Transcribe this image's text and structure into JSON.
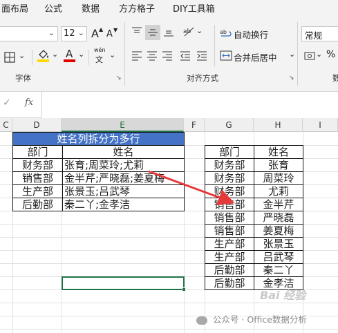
{
  "ribbon": {
    "tabs": [
      "面布局",
      "公式",
      "数据",
      "方方格子",
      "DIY工具箱"
    ],
    "font_size_value": "12",
    "grow_font_label": "A",
    "shrink_font_label": "A",
    "font_color_label": "A",
    "phonetic_label": "wén",
    "phonetic_sub": "文",
    "wrap_text_label": "自动换行",
    "merge_center_label": "合并后居中",
    "number_format_value": "常规",
    "percent_label": "%",
    "groups": {
      "font": "字体",
      "alignment": "对齐方式",
      "number_cut": "数"
    },
    "colors": {
      "fill_highlight": "#ffd800",
      "font_red": "#e00000"
    }
  },
  "formula_bar": {
    "fx_label": "fx",
    "check_label": "✓",
    "content": ""
  },
  "grid": {
    "columns": [
      "C",
      "D",
      "E",
      "F",
      "G",
      "H",
      "I"
    ],
    "selected_column": "E"
  },
  "left_table": {
    "title": "姓名列拆分为多行",
    "headers": [
      "部门",
      "姓名"
    ],
    "rows": [
      [
        "财务部",
        "张育;周菜玲;尤莉"
      ],
      [
        "销售部",
        "金半芹;严晓磊;姜夏梅"
      ],
      [
        "生产部",
        "张景玉;吕武琴"
      ],
      [
        "后勤部",
        "秦二丫;金孝洁"
      ]
    ]
  },
  "right_table": {
    "headers": [
      "部门",
      "姓名"
    ],
    "rows": [
      [
        "财务部",
        "张育"
      ],
      [
        "财务部",
        "周菜玲"
      ],
      [
        "财务部",
        "尤莉"
      ],
      [
        "销售部",
        "金半芹"
      ],
      [
        "销售部",
        "严晓磊"
      ],
      [
        "销售部",
        "姜夏梅"
      ],
      [
        "生产部",
        "张景玉"
      ],
      [
        "生产部",
        "吕武琴"
      ],
      [
        "后勤部",
        "秦二丫"
      ],
      [
        "后勤部",
        "金孝洁"
      ]
    ]
  },
  "watermark": {
    "text": "公众号 · Office数据分析",
    "baidu": "Bai 经验"
  }
}
